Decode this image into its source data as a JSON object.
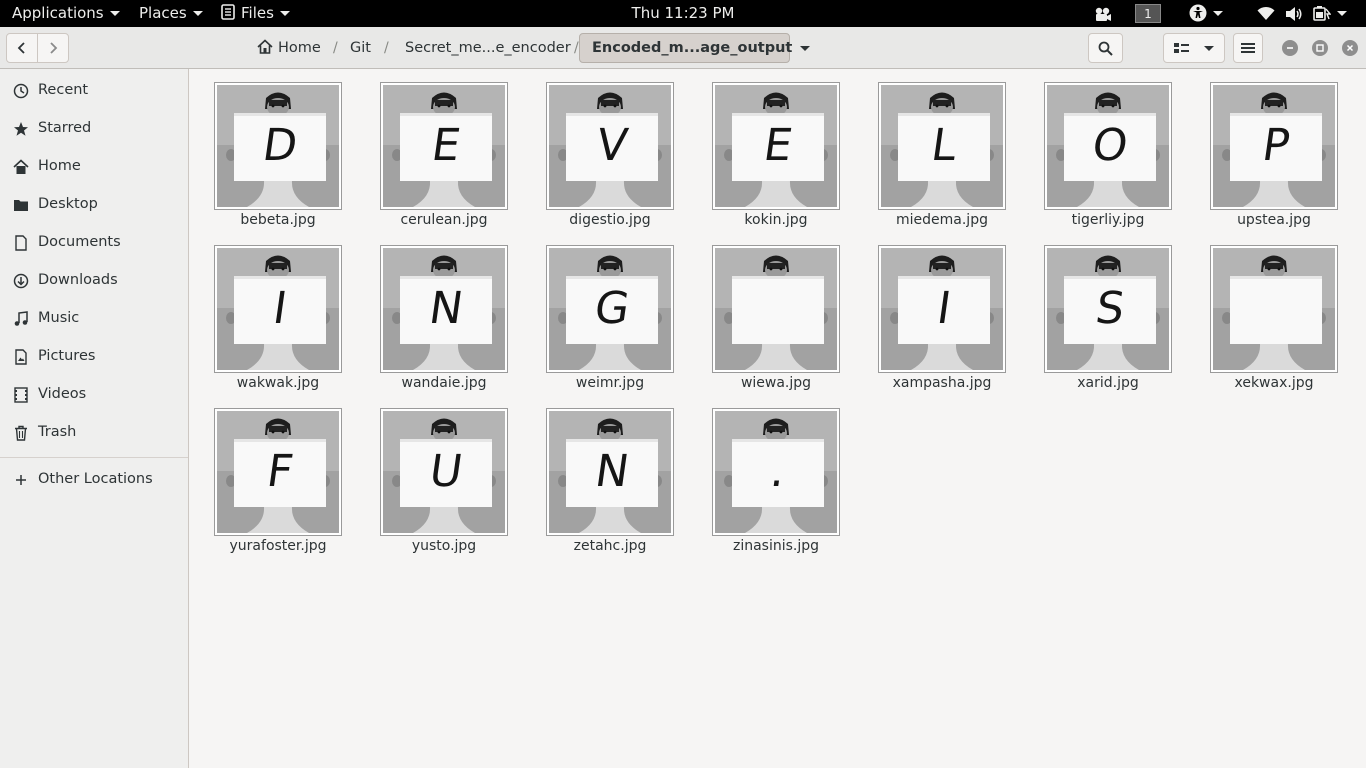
{
  "top_panel": {
    "applications": "Applications",
    "places": "Places",
    "files_menu": "Files",
    "clock": "Thu 11:23 PM",
    "workspace": "1",
    "icons": [
      "screen-record-icon",
      "accessibility-icon",
      "wifi-icon",
      "volume-icon",
      "battery-icon"
    ]
  },
  "header": {
    "breadcrumbs": [
      "Home",
      "Git",
      "Secret_me...e_encoder"
    ],
    "current_folder": "Encoded_m...age_output",
    "icons": [
      "back-icon",
      "forward-icon",
      "home-icon",
      "search-icon",
      "view-list-icon",
      "hamburger-menu-icon",
      "minimize-icon",
      "maximize-icon",
      "close-icon"
    ]
  },
  "sidebar": {
    "items": [
      {
        "label": "Recent",
        "icon": "clock-icon"
      },
      {
        "label": "Starred",
        "icon": "star-icon"
      },
      {
        "label": "Home",
        "icon": "home-icon"
      },
      {
        "label": "Desktop",
        "icon": "folder-icon"
      },
      {
        "label": "Documents",
        "icon": "document-icon"
      },
      {
        "label": "Downloads",
        "icon": "download-icon"
      },
      {
        "label": "Music",
        "icon": "music-icon"
      },
      {
        "label": "Pictures",
        "icon": "picture-icon"
      },
      {
        "label": "Videos",
        "icon": "video-icon"
      },
      {
        "label": "Trash",
        "icon": "trash-icon"
      }
    ],
    "other_locations": "Other Locations"
  },
  "files": [
    {
      "name": "bebeta.jpg",
      "letter": "D"
    },
    {
      "name": "cerulean.jpg",
      "letter": "E"
    },
    {
      "name": "digestio.jpg",
      "letter": "V"
    },
    {
      "name": "kokin.jpg",
      "letter": "E"
    },
    {
      "name": "miedema.jpg",
      "letter": "L"
    },
    {
      "name": "tigerliy.jpg",
      "letter": "O"
    },
    {
      "name": "upstea.jpg",
      "letter": "P"
    },
    {
      "name": "wakwak.jpg",
      "letter": "I"
    },
    {
      "name": "wandaie.jpg",
      "letter": "N"
    },
    {
      "name": "weimr.jpg",
      "letter": "G"
    },
    {
      "name": "wiewa.jpg",
      "letter": ""
    },
    {
      "name": "xampasha.jpg",
      "letter": "I"
    },
    {
      "name": "xarid.jpg",
      "letter": "S"
    },
    {
      "name": "xekwax.jpg",
      "letter": ""
    },
    {
      "name": "yurafoster.jpg",
      "letter": "F"
    },
    {
      "name": "yusto.jpg",
      "letter": "U"
    },
    {
      "name": "zetahc.jpg",
      "letter": "N"
    },
    {
      "name": "zinasinis.jpg",
      "letter": "."
    }
  ]
}
